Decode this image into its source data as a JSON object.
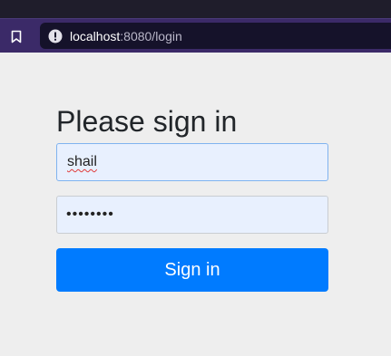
{
  "browser": {
    "url_host": "localhost",
    "url_rest": ":8080/login"
  },
  "login": {
    "title": "Please sign in",
    "username_value": "shail",
    "password_value": "••••••••",
    "submit_label": "Sign in"
  },
  "icons": {
    "bookmark": "bookmark-icon",
    "info": "info-icon"
  },
  "colors": {
    "primary": "#007bff",
    "page_background": "#eeeeee",
    "field_background": "#e8f0fe",
    "browser_bar": "#3b2a68"
  }
}
